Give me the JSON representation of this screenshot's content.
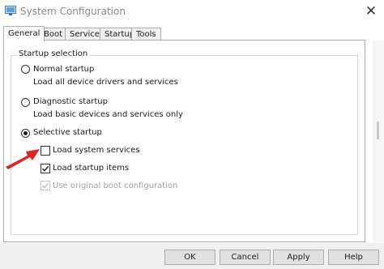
{
  "window": {
    "title": "System Configuration",
    "close_glyph": "✕",
    "icon": "system-config-icon"
  },
  "tabs": [
    {
      "label": "General",
      "active": true
    },
    {
      "label": "Boot",
      "active": false
    },
    {
      "label": "Services",
      "active": false
    },
    {
      "label": "Startup",
      "active": false
    },
    {
      "label": "Tools",
      "active": false
    }
  ],
  "startup_selection": {
    "group_label": "Startup selection",
    "normal": {
      "label": "Normal startup",
      "description": "Load all device drivers and services",
      "selected": false
    },
    "diagnostic": {
      "label": "Diagnostic startup",
      "description": "Load basic devices and services only",
      "selected": false
    },
    "selective": {
      "label": "Selective startup",
      "selected": true,
      "options": [
        {
          "label": "Load system services",
          "checked": false,
          "enabled": true
        },
        {
          "label": "Load startup items",
          "checked": true,
          "enabled": true
        },
        {
          "label": "Use original boot configuration",
          "checked": true,
          "enabled": false
        }
      ]
    }
  },
  "annotation": {
    "arrow_color": "#e02424"
  },
  "buttons": {
    "ok": "OK",
    "cancel": "Cancel",
    "apply": "Apply",
    "help": "Help"
  }
}
